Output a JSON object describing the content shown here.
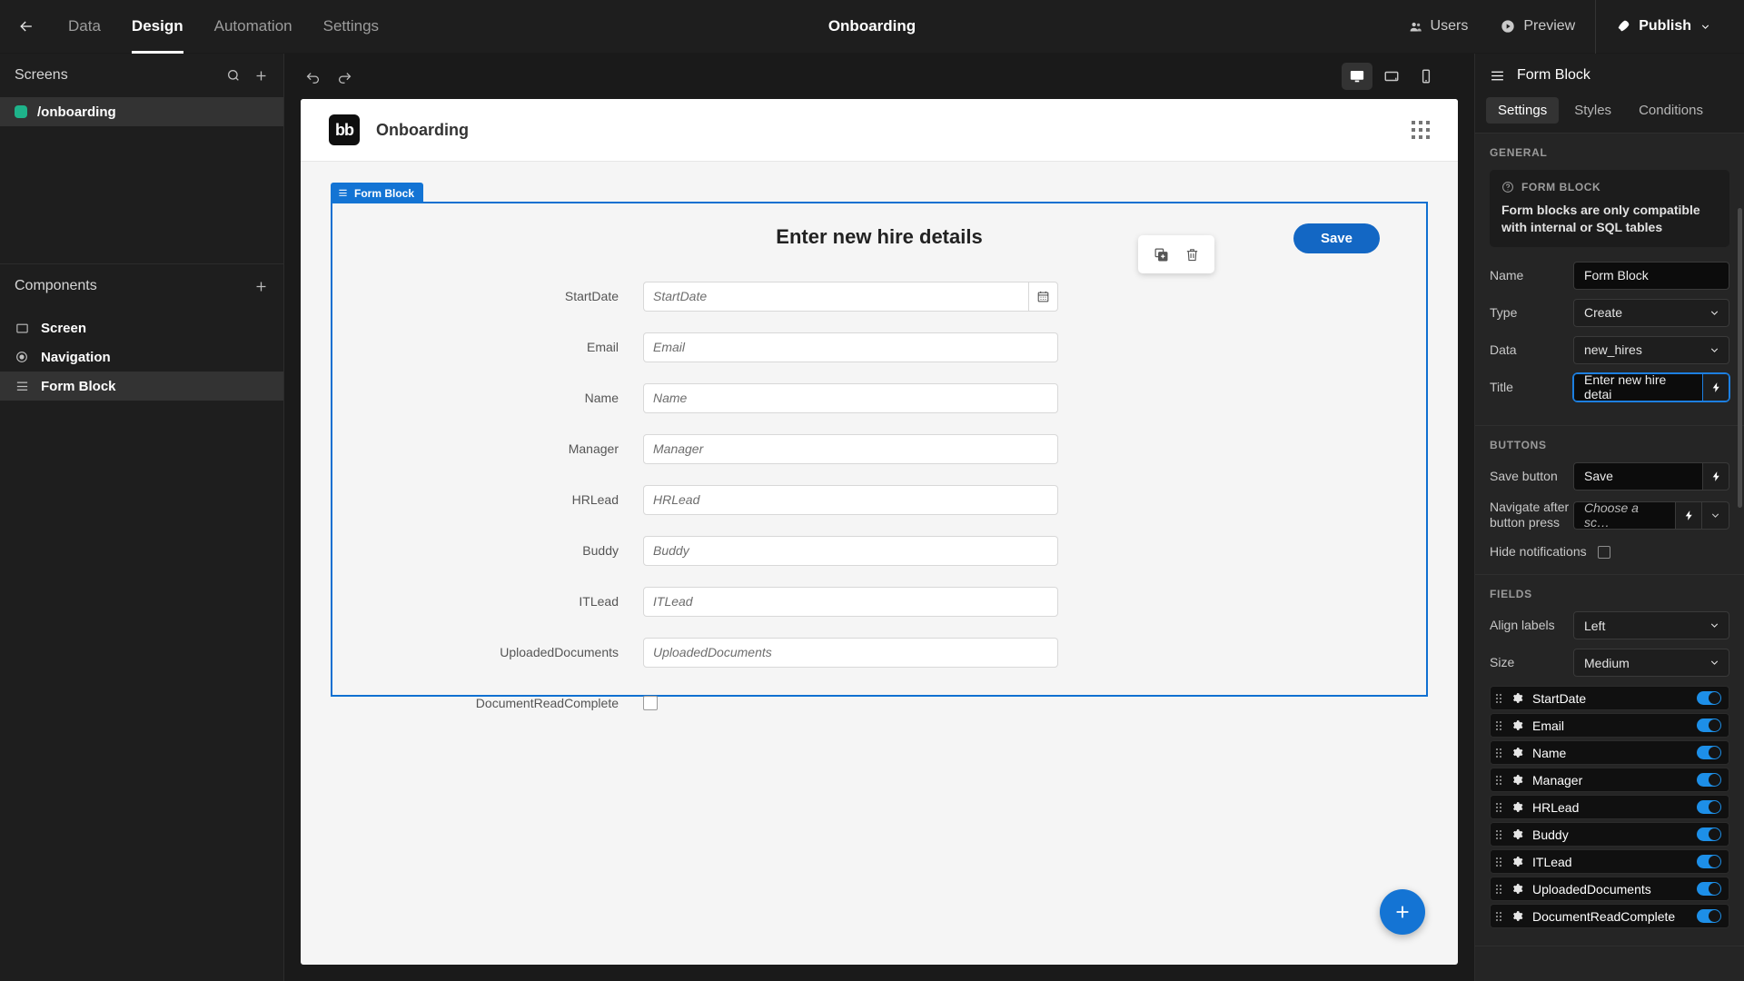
{
  "topbar": {
    "back_icon": "arrow-left-icon",
    "tabs": [
      {
        "label": "Data",
        "active": false
      },
      {
        "label": "Design",
        "active": true
      },
      {
        "label": "Automation",
        "active": false
      },
      {
        "label": "Settings",
        "active": false
      }
    ],
    "app_title": "Onboarding",
    "users_label": "Users",
    "preview_label": "Preview",
    "publish_label": "Publish"
  },
  "left_panel": {
    "screens_title": "Screens",
    "search_icon": "search-icon",
    "add_icon": "plus-icon",
    "screens": [
      {
        "label": "/onboarding",
        "color": "#1eb38a",
        "selected": true
      }
    ],
    "components_title": "Components",
    "components_add_icon": "plus-icon",
    "components": [
      {
        "label": "Screen",
        "icon": "screen-icon",
        "selected": false
      },
      {
        "label": "Navigation",
        "icon": "eye-icon",
        "selected": false
      },
      {
        "label": "Form Block",
        "icon": "form-block-icon",
        "selected": true
      }
    ]
  },
  "center": {
    "undo_icon": "undo-icon",
    "redo_icon": "redo-icon",
    "devices": [
      {
        "name": "desktop-icon",
        "active": true
      },
      {
        "name": "tablet-icon",
        "active": false
      },
      {
        "name": "mobile-icon",
        "active": false
      }
    ],
    "canvas_header": {
      "logo_text": "bb",
      "title": "Onboarding",
      "grid_icon": "grid-dots-icon"
    },
    "float_actions": [
      {
        "name": "duplicate-icon"
      },
      {
        "name": "delete-icon"
      }
    ],
    "form_block": {
      "tag_label": "Form Block",
      "tag_icon": "form-block-icon",
      "title": "Enter new hire details",
      "save_label": "Save",
      "fields": [
        {
          "label": "StartDate",
          "placeholder": "StartDate",
          "type": "date",
          "addon_icon": "calendar-icon"
        },
        {
          "label": "Email",
          "placeholder": "Email",
          "type": "text"
        },
        {
          "label": "Name",
          "placeholder": "Name",
          "type": "text"
        },
        {
          "label": "Manager",
          "placeholder": "Manager",
          "type": "text"
        },
        {
          "label": "HRLead",
          "placeholder": "HRLead",
          "type": "text"
        },
        {
          "label": "Buddy",
          "placeholder": "Buddy",
          "type": "text"
        },
        {
          "label": "ITLead",
          "placeholder": "ITLead",
          "type": "text"
        },
        {
          "label": "UploadedDocuments",
          "placeholder": "UploadedDocuments",
          "type": "text"
        },
        {
          "label": "DocumentReadComplete",
          "placeholder": "",
          "type": "checkbox"
        }
      ]
    },
    "fab_icon": "plus-icon"
  },
  "right_panel": {
    "header_title": "Form Block",
    "header_icon": "form-block-icon",
    "tabs": [
      {
        "label": "Settings",
        "active": true
      },
      {
        "label": "Styles",
        "active": false
      },
      {
        "label": "Conditions",
        "active": false
      }
    ],
    "general": {
      "section_title": "GENERAL",
      "info_icon": "question-circle-icon",
      "info_title": "FORM BLOCK",
      "info_text": "Form blocks are only compatible with internal or SQL tables",
      "name_label": "Name",
      "name_value": "Form Block",
      "type_label": "Type",
      "type_value": "Create",
      "data_label": "Data",
      "data_value": "new_hires",
      "title_label": "Title",
      "title_value": "Enter new hire detai",
      "bolt_icon": "lightning-icon",
      "caret_icon": "chevron-down-icon"
    },
    "buttons": {
      "section_title": "BUTTONS",
      "save_button_label": "Save button",
      "save_button_value": "Save",
      "navigate_label": "Navigate after button press",
      "navigate_placeholder": "Choose a sc…",
      "hide_notifications_label": "Hide notifications",
      "hide_notifications_checked": false
    },
    "fields": {
      "section_title": "FIELDS",
      "align_labels_label": "Align labels",
      "align_labels_value": "Left",
      "size_label": "Size",
      "size_value": "Medium",
      "items": [
        {
          "name": "StartDate",
          "enabled": true
        },
        {
          "name": "Email",
          "enabled": true
        },
        {
          "name": "Name",
          "enabled": true
        },
        {
          "name": "Manager",
          "enabled": true
        },
        {
          "name": "HRLead",
          "enabled": true
        },
        {
          "name": "Buddy",
          "enabled": true
        },
        {
          "name": "ITLead",
          "enabled": true
        },
        {
          "name": "UploadedDocuments",
          "enabled": true
        },
        {
          "name": "DocumentReadComplete",
          "enabled": true
        }
      ],
      "drag_icon": "drag-handle-icon",
      "gear_icon": "gear-icon"
    }
  },
  "colors": {
    "accent_blue": "#1474d4",
    "screen_dot_green": "#1eb38a",
    "panel_bg": "#1e1e1e",
    "canvas_bg": "#f5f5f5"
  }
}
